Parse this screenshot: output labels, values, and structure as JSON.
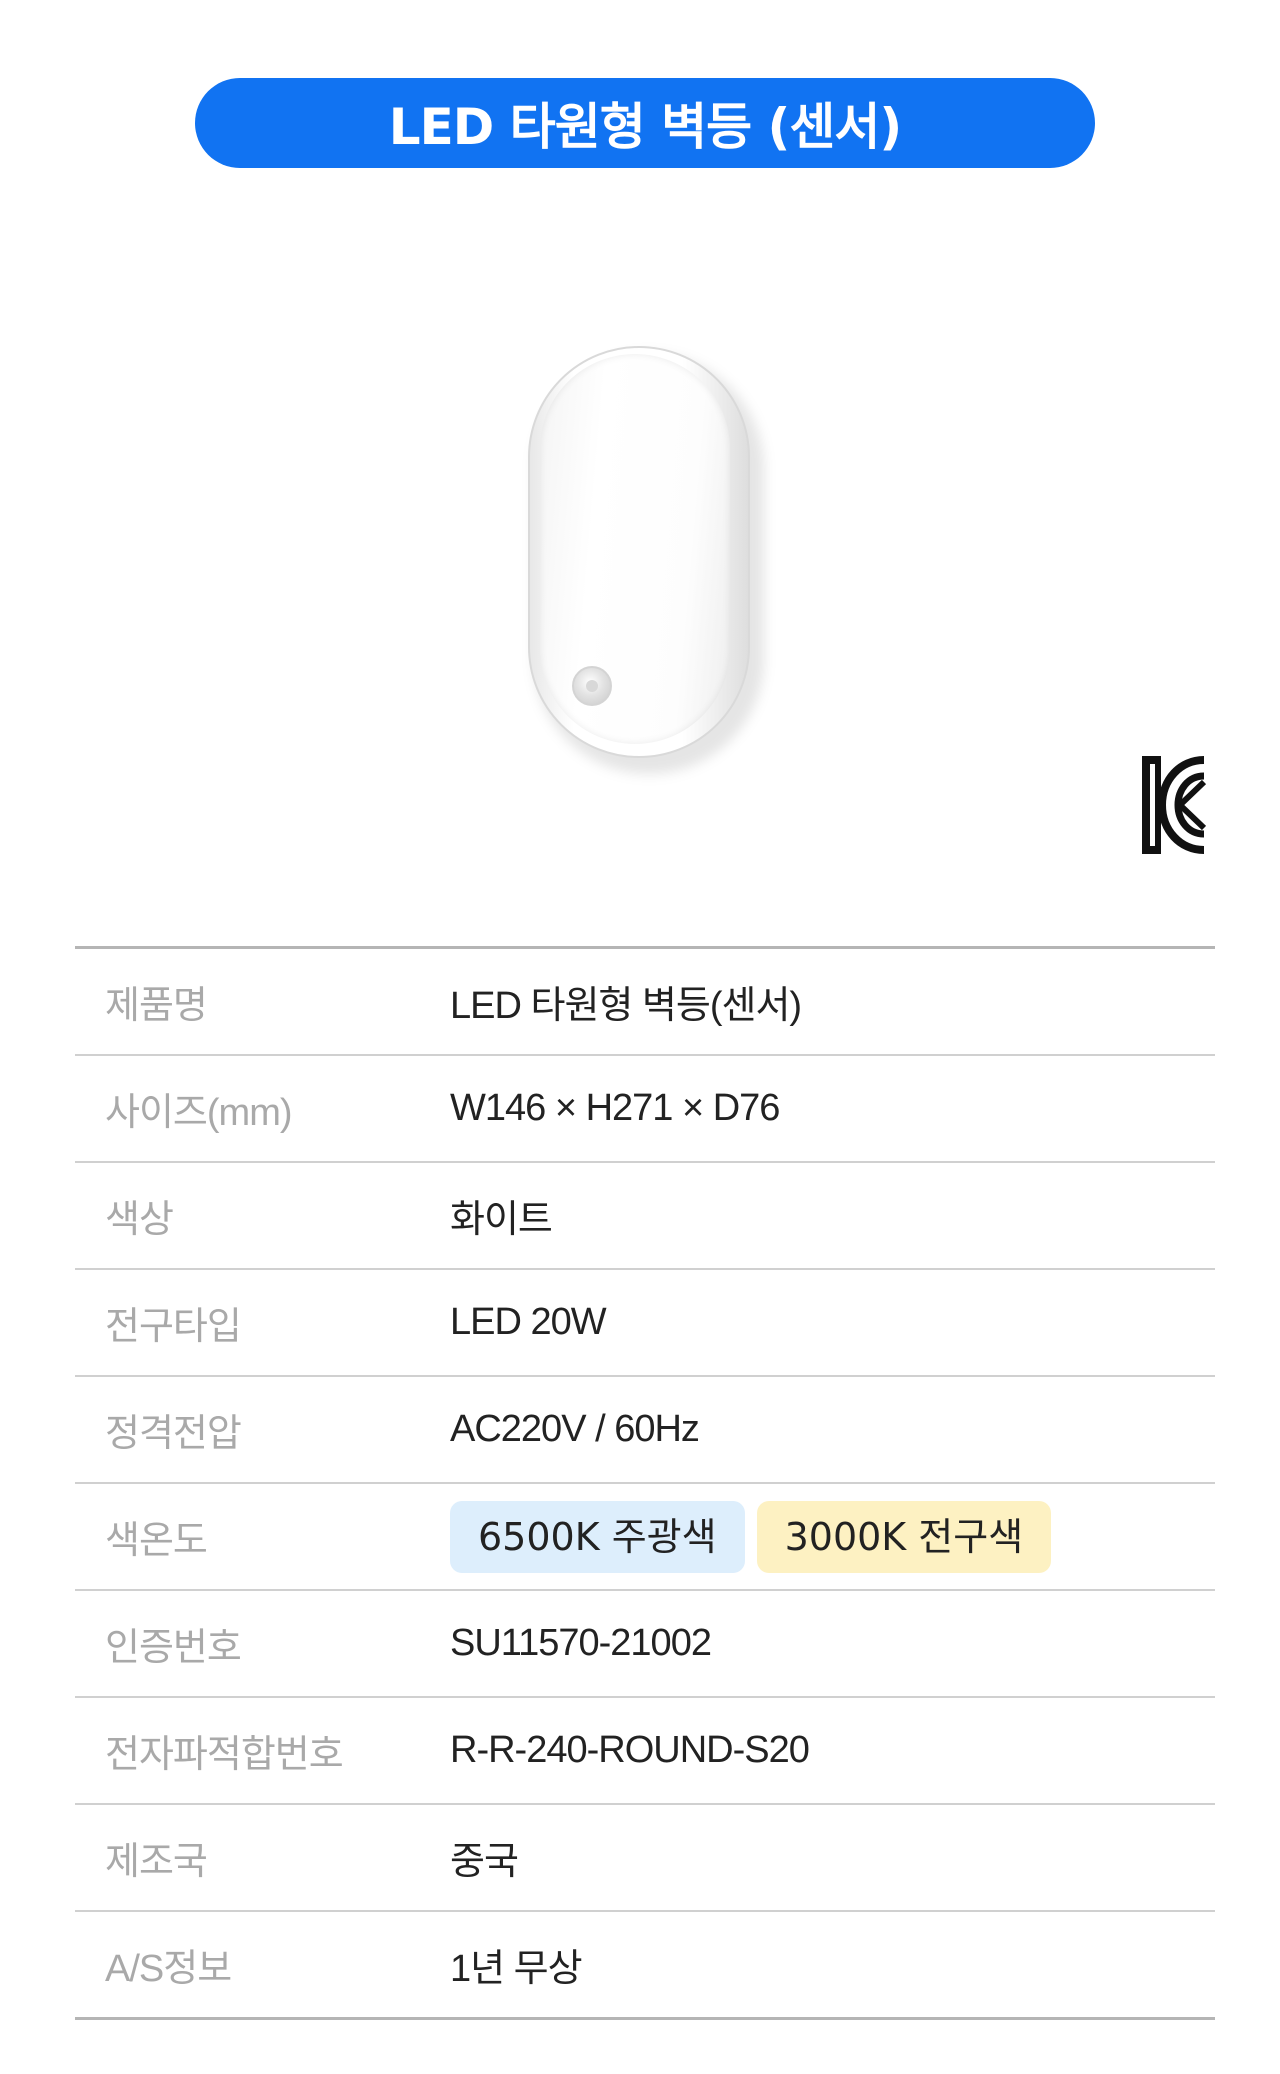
{
  "header": {
    "title": "LED 타원형 벽등 (센서)",
    "accent_color": "#1173f2"
  },
  "product_image": {
    "icon": "oval-wall-lamp-with-sensor"
  },
  "certification": {
    "icon": "kc-mark-icon"
  },
  "specs": [
    {
      "label": "제품명",
      "value": "LED 타원형 벽등(센서)"
    },
    {
      "label": "사이즈(mm)",
      "value": "W146 × H271 × D76"
    },
    {
      "label": "색상",
      "value": "화이트"
    },
    {
      "label": "전구타입",
      "value": "LED 20W"
    },
    {
      "label": "정격전압",
      "value": "AC220V / 60Hz"
    },
    {
      "label": "색온도",
      "chips": [
        {
          "text": "6500K 주광색",
          "color": "#ddeefc"
        },
        {
          "text": "3000K 전구색",
          "color": "#fdf1c2"
        }
      ]
    },
    {
      "label": "인증번호",
      "value": "SU11570-21002"
    },
    {
      "label": "전자파적합번호",
      "value": "R-R-240-ROUND-S20"
    },
    {
      "label": "제조국",
      "value": "중국"
    },
    {
      "label": "A/S정보",
      "value": "1년 무상"
    }
  ]
}
